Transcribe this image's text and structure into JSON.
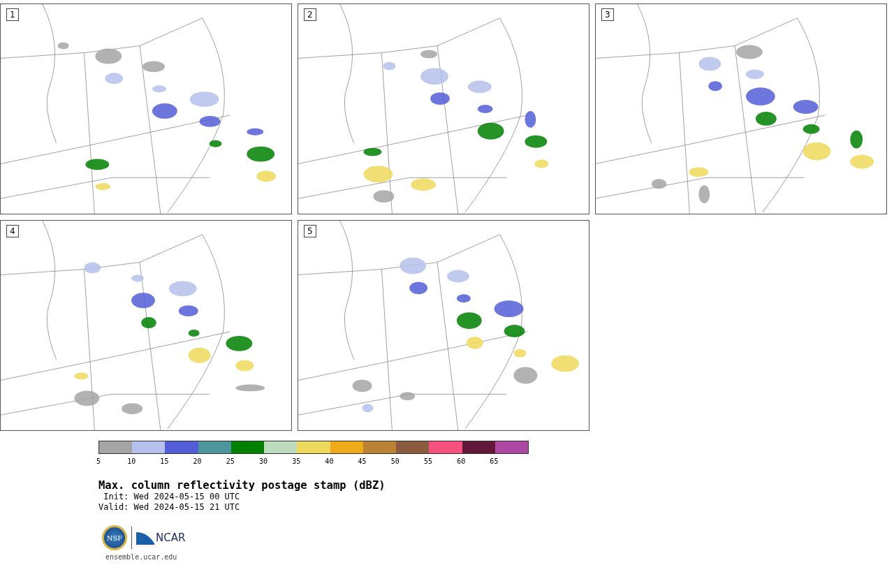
{
  "panels": [
    {
      "label": "1"
    },
    {
      "label": "2"
    },
    {
      "label": "3"
    },
    {
      "label": "4"
    },
    {
      "label": "5"
    }
  ],
  "colorbar": {
    "segments": [
      {
        "color": "#a5a5a5"
      },
      {
        "color": "#b5c1ec"
      },
      {
        "color": "#525ed6"
      },
      {
        "color": "#4f959c"
      },
      {
        "color": "#008000"
      },
      {
        "color": "#bddcbd"
      },
      {
        "color": "#efd95c"
      },
      {
        "color": "#eeaa19"
      },
      {
        "color": "#bb8233"
      },
      {
        "color": "#8a5b3f"
      },
      {
        "color": "#f6507e"
      },
      {
        "color": "#611735"
      },
      {
        "color": "#ac4aa3"
      }
    ],
    "ticks": [
      "5",
      "10",
      "15",
      "20",
      "25",
      "30",
      "35",
      "40",
      "45",
      "50",
      "55",
      "60",
      "65"
    ]
  },
  "title": "Max. column reflectivity postage stamp (dBZ)",
  "init": " Init: Wed 2024-05-15 00 UTC",
  "valid": "Valid: Wed 2024-05-15 21 UTC",
  "logo": {
    "seal": "NSF",
    "wordmark": "NCAR"
  },
  "site": "ensemble.ucar.edu"
}
